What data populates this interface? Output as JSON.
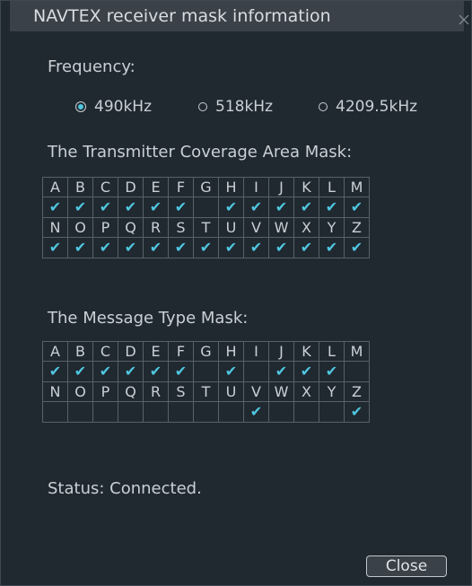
{
  "window": {
    "title": "NAVTEX receiver mask information"
  },
  "frequency": {
    "label": "Frequency:",
    "options": [
      {
        "label": "490kHz",
        "selected": true
      },
      {
        "label": "518kHz",
        "selected": false
      },
      {
        "label": "4209.5kHz",
        "selected": false
      }
    ]
  },
  "transmitter_mask": {
    "heading": "The Transmitter Coverage Area Mask:",
    "row1": {
      "letters": [
        "A",
        "B",
        "C",
        "D",
        "E",
        "F",
        "G",
        "H",
        "I",
        "J",
        "K",
        "L",
        "M"
      ],
      "checked": [
        true,
        true,
        true,
        true,
        true,
        true,
        false,
        true,
        true,
        true,
        true,
        true,
        true
      ]
    },
    "row2": {
      "letters": [
        "N",
        "O",
        "P",
        "Q",
        "R",
        "S",
        "T",
        "U",
        "V",
        "W",
        "X",
        "Y",
        "Z"
      ],
      "checked": [
        true,
        true,
        true,
        true,
        true,
        true,
        true,
        true,
        true,
        true,
        true,
        true,
        true
      ]
    }
  },
  "message_type_mask": {
    "heading": "The Message Type Mask:",
    "row1": {
      "letters": [
        "A",
        "B",
        "C",
        "D",
        "E",
        "F",
        "G",
        "H",
        "I",
        "J",
        "K",
        "L",
        "M"
      ],
      "checked": [
        true,
        true,
        true,
        true,
        true,
        true,
        false,
        true,
        false,
        true,
        true,
        true,
        false
      ]
    },
    "row2": {
      "letters": [
        "N",
        "O",
        "P",
        "Q",
        "R",
        "S",
        "T",
        "U",
        "V",
        "W",
        "X",
        "Y",
        "Z"
      ],
      "checked": [
        false,
        false,
        false,
        false,
        false,
        false,
        false,
        false,
        true,
        false,
        false,
        false,
        true
      ]
    }
  },
  "status": {
    "text": "Status: Connected."
  },
  "buttons": {
    "close_label": "Close"
  },
  "icons": {
    "check": "check-icon",
    "close": "close-icon",
    "radio": "radio-button-icon"
  },
  "colors": {
    "accent": "#4fc7e0",
    "background": "#202830",
    "titlebar": "#3a4148",
    "text": "#c9d0d6",
    "grid": "#58606a"
  }
}
